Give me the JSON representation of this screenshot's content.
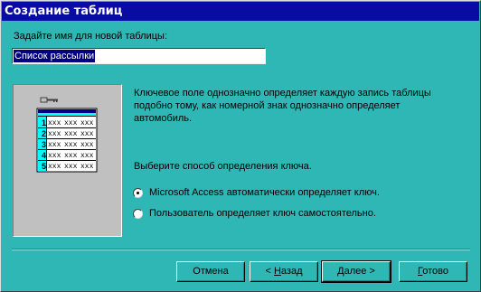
{
  "window": {
    "title": "Создание таблиц"
  },
  "prompt": {
    "label": "Задайте имя для новой таблицы:"
  },
  "table_name": {
    "value": "Список рассылки"
  },
  "explanation": "Ключевое поле однозначно определяет каждую запись таблицы подобно тому, как номерной знак однозначно определяет автомобиль.",
  "key_method": {
    "label": "Выберите способ определения ключа.",
    "options": [
      {
        "label": "Microsoft Access автоматически определяет ключ.",
        "selected": true
      },
      {
        "label": "Пользователь определяет ключ самостоятельно.",
        "selected": false
      }
    ]
  },
  "illustration": {
    "row_numbers": [
      "1",
      "2",
      "3",
      "4",
      "5"
    ],
    "cell_text": "xxx",
    "key_icon": "key-icon"
  },
  "buttons": {
    "cancel": "Отмена",
    "back_prefix": "< ",
    "back_hotkey": "Н",
    "back_rest": "азад",
    "next_hotkey": "Д",
    "next_rest": "алее >",
    "finish_hotkey": "Г",
    "finish_rest": "отово"
  },
  "colors": {
    "dialog": "#2fb7b5",
    "title_bar": "#0a0aa4",
    "selection": "#000080",
    "table_header": "#00ffff"
  }
}
